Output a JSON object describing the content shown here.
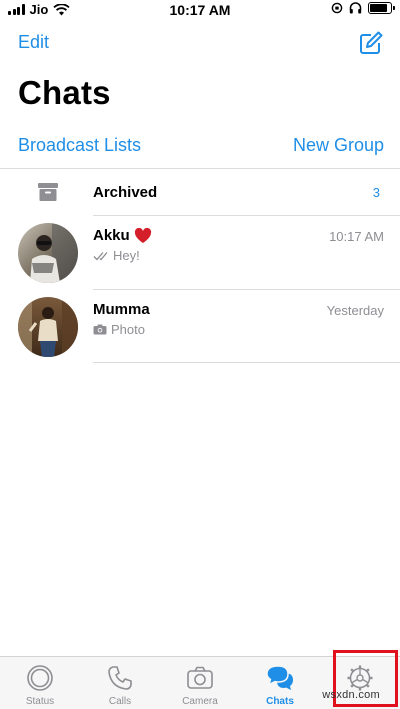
{
  "status_bar": {
    "carrier": "Jio",
    "time": "10:17 AM",
    "battery_level": 0.85
  },
  "header": {
    "edit_label": "Edit",
    "title": "Chats",
    "broadcast_label": "Broadcast Lists",
    "new_group_label": "New Group"
  },
  "archived": {
    "label": "Archived",
    "count": "3"
  },
  "chats": [
    {
      "name": "Akku",
      "emoji": "❤️",
      "time": "10:17 AM",
      "preview": "Hey!",
      "preview_icon": "double-check-icon"
    },
    {
      "name": "Mumma",
      "time": "Yesterday",
      "preview": "Photo",
      "preview_icon": "camera-icon"
    }
  ],
  "tabs": [
    {
      "label": "Status",
      "icon": "status-icon"
    },
    {
      "label": "Calls",
      "icon": "phone-icon"
    },
    {
      "label": "Camera",
      "icon": "camera-icon"
    },
    {
      "label": "Chats",
      "icon": "chats-icon",
      "active": true
    },
    {
      "label": "Settings",
      "icon": "settings-icon"
    }
  ],
  "watermark": "wsxdn.com",
  "colors": {
    "accent": "#1f8ee6",
    "highlight": "#e0101f",
    "secondary_text": "#8e8e93"
  }
}
